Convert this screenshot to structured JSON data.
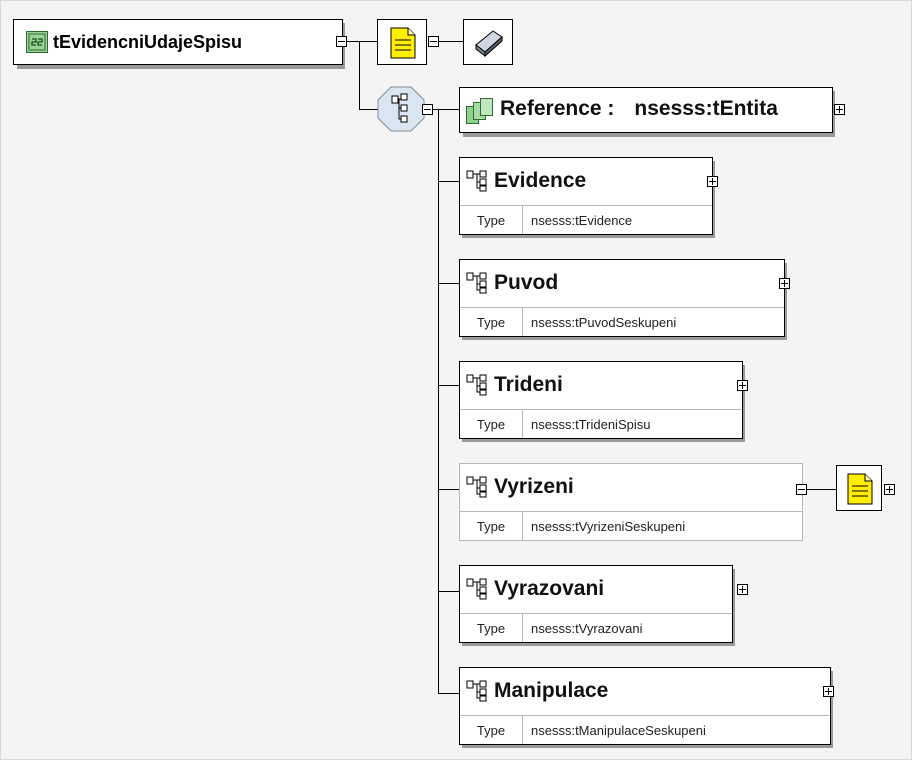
{
  "root": {
    "name": "tEvidencniUdajeSpisu"
  },
  "reference": {
    "label": "Reference :",
    "type": "nsesss:tEntita"
  },
  "type_label": "Type",
  "elements": [
    {
      "name": "Evidence",
      "type": "nsesss:tEvidence"
    },
    {
      "name": "Puvod",
      "type": "nsesss:tPuvodSeskupeni"
    },
    {
      "name": "Trideni",
      "type": "nsesss:tTrideniSpisu"
    },
    {
      "name": "Vyrizeni",
      "type": "nsesss:tVyrizeniSeskupeni",
      "optional": true
    },
    {
      "name": "Vyrazovani",
      "type": "nsesss:tVyrazovani"
    },
    {
      "name": "Manipulace",
      "type": "nsesss:tManipulaceSeskupeni"
    }
  ],
  "icons": [
    "complex-type-icon",
    "annotation-icon",
    "attributes-icon",
    "sequence-compositor-icon",
    "group-reference-icon",
    "element-icon",
    "expand-icon",
    "collapse-icon"
  ],
  "colors": {
    "complex_type_fill": "#9ad29a",
    "annotation_fill": "#ffee00",
    "compositor_fill": "#d9e6f2",
    "faded_border": "#b8b8b8"
  }
}
